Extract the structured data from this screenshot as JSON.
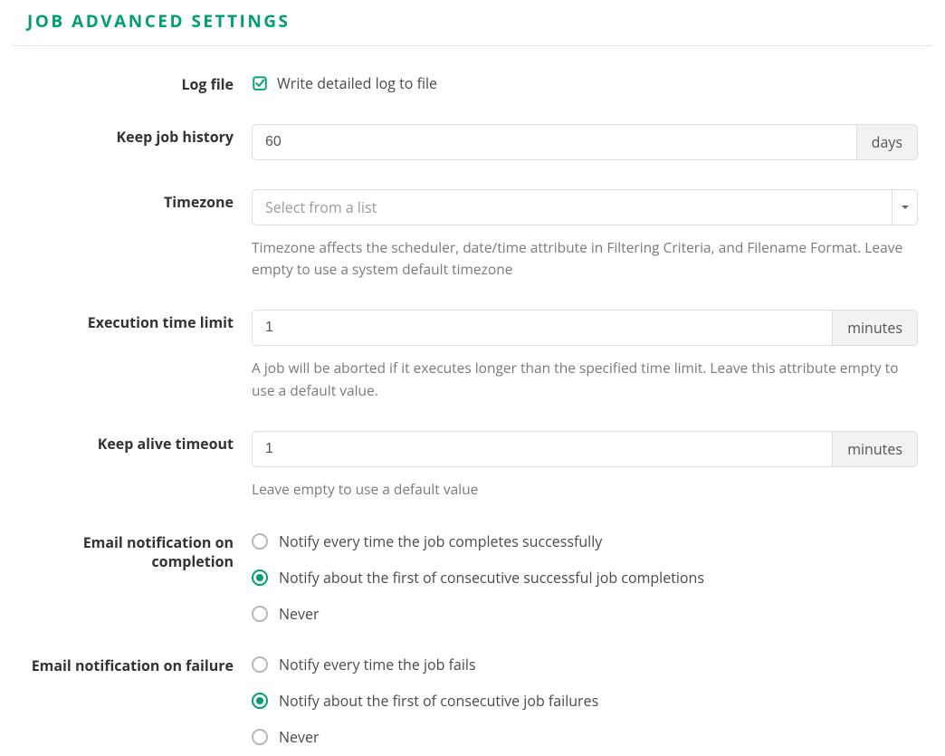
{
  "title": "JOB ADVANCED SETTINGS",
  "labels": {
    "log_file": "Log file",
    "keep_history": "Keep job history",
    "timezone": "Timezone",
    "exec_limit": "Execution time limit",
    "keep_alive": "Keep alive timeout",
    "email_complete": "Email notification on completion",
    "email_failure": "Email notification on failure"
  },
  "log_file": {
    "checked": true,
    "text": "Write detailed log to file"
  },
  "keep_history": {
    "value": "60",
    "unit": "days"
  },
  "timezone": {
    "placeholder": "Select from a list",
    "help": "Timezone affects the scheduler, date/time attribute in Filtering Criteria, and Filename Format. Leave empty to use a system default timezone"
  },
  "exec_limit": {
    "value": "1",
    "unit": "minutes",
    "help": "A job will be aborted if it executes longer than the specified time limit. Leave this attribute empty to use a default value."
  },
  "keep_alive": {
    "value": "1",
    "unit": "minutes",
    "help": "Leave empty to use a default value"
  },
  "email_complete": {
    "options": [
      "Notify every time the job completes successfully",
      "Notify about the first of consecutive successful job completions",
      "Never"
    ],
    "selected": 1
  },
  "email_failure": {
    "options": [
      "Notify every time the job fails",
      "Notify about the first of consecutive job failures",
      "Never"
    ],
    "selected": 1
  }
}
